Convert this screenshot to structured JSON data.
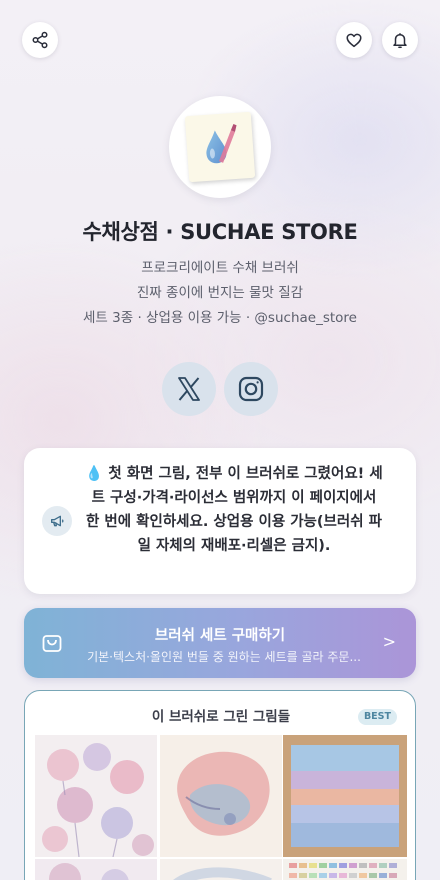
{
  "header": {
    "share_icon": "share-icon",
    "heart_icon": "heart-icon",
    "bell_icon": "bell-icon"
  },
  "profile": {
    "avatar_icon": "brush-drop-logo",
    "name": "수채상점 · SUCHAE STORE",
    "desc_line1": "프로크리에이트 수채 브러쉬",
    "desc_line2": "진짜 종이에 번지는 물맛 질감",
    "desc_line3": "세트 3종 · 상업용 이용 가능 · @suchae_store"
  },
  "social": [
    {
      "icon": "x-logo-icon"
    },
    {
      "icon": "instagram-icon"
    }
  ],
  "notice": {
    "icon": "megaphone-icon",
    "text": "💧 첫 화면 그림, 전부 이 브러쉬로 그렸어요! 세트 구성·가격·라이선스 범위까지 이 페이지에서 한 번에 확인하세요. 상업용 이용 가능(브러쉬 파일 자체의 재배포·리셀은 금지)."
  },
  "buy": {
    "icon": "shopping-bag-icon",
    "title": "브러쉬 세트 구매하기",
    "subtitle": "기본·텍스처·올인원 번들 중 원하는 세트를 골라 주문...",
    "arrow": ">"
  },
  "gallery": {
    "title": "이 브러쉬로 그린 그림들",
    "badge": "BEST"
  },
  "colors": {
    "accent_gradient_start": "#7fb3d6",
    "accent_gradient_end": "#ab95d8",
    "gallery_border": "#78a6b6",
    "social_bg": "#d9e2ec"
  }
}
